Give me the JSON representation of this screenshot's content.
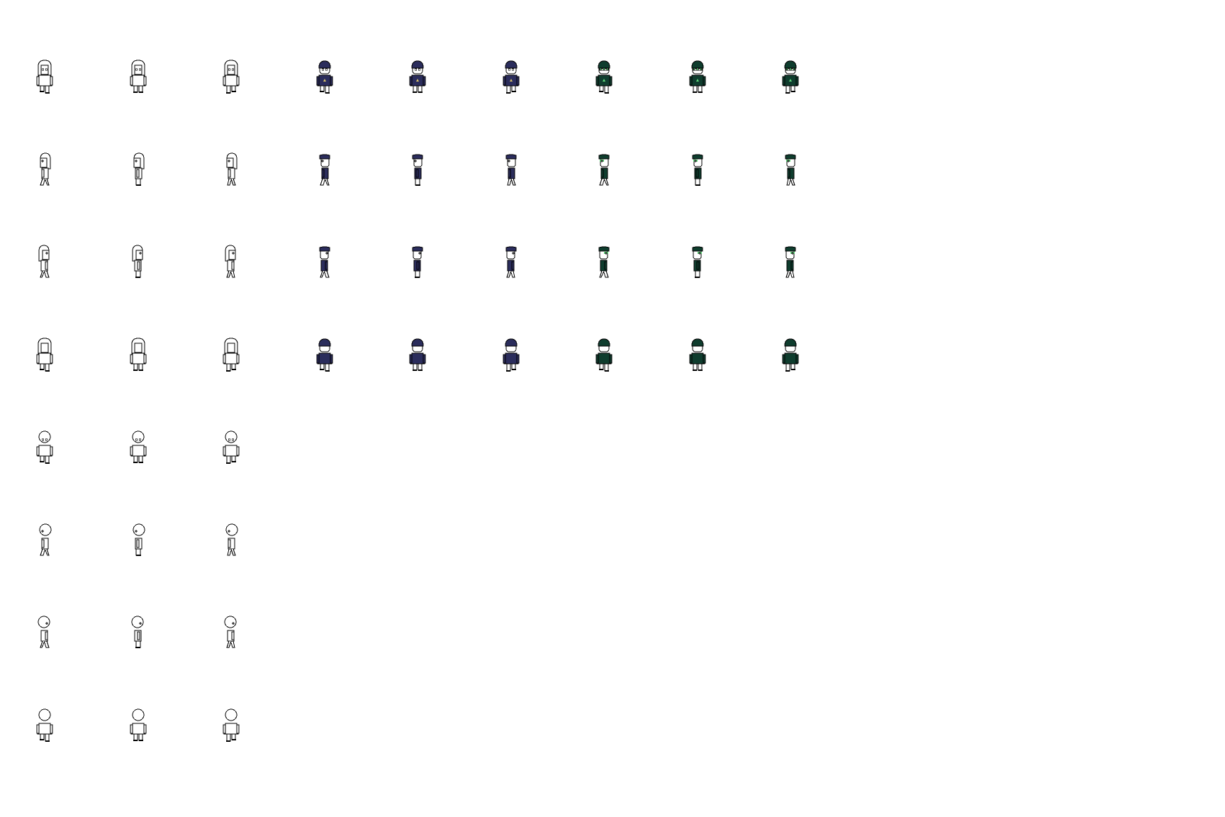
{
  "sheet": {
    "background": "#ffffff",
    "outline_color": "#000000",
    "skin_color": "#ffffff",
    "characters": [
      {
        "name": "long-hair-white",
        "hair": "long",
        "shirt": "#ffffff",
        "pants": "#ffffff",
        "accent": null
      },
      {
        "name": "short-hair-navy",
        "hair": "cap",
        "shirt": "#2b2d5c",
        "pants": "#ffffff",
        "hair_color": "#2b2d5c",
        "accent": "#d8c26a"
      },
      {
        "name": "short-hair-green-visor",
        "hair": "cap",
        "shirt": "#0f3d2e",
        "pants": "#ffffff",
        "hair_color": "#0f3d2e",
        "accent": "#5fd87a"
      },
      {
        "name": "round-head-white",
        "hair": "round",
        "shirt": "#ffffff",
        "pants": "#ffffff",
        "accent": null
      }
    ],
    "directions": [
      "front",
      "side-left",
      "side-right",
      "back"
    ],
    "frames": [
      "frame-1",
      "frame-2",
      "frame-3"
    ]
  }
}
